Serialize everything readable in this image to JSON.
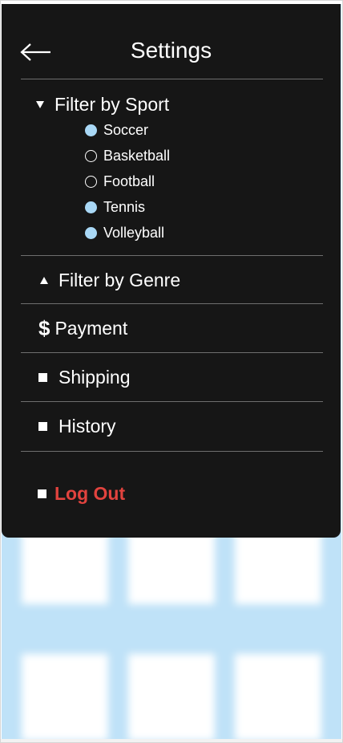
{
  "header": {
    "title": "Settings",
    "back_icon": "arrow-left-icon"
  },
  "filter_sport": {
    "label": "Filter by Sport",
    "expanded": true,
    "options": [
      {
        "label": "Soccer",
        "selected": true
      },
      {
        "label": "Basketball",
        "selected": false
      },
      {
        "label": "Football",
        "selected": false
      },
      {
        "label": "Tennis",
        "selected": true
      },
      {
        "label": "Volleyball",
        "selected": true
      }
    ]
  },
  "filter_genre": {
    "label": "Filter by Genre",
    "expanded": false
  },
  "menu": {
    "payment": {
      "label": "Payment",
      "icon": "$"
    },
    "shipping": {
      "label": "Shipping"
    },
    "history": {
      "label": "History"
    },
    "logout": {
      "label": "Log Out"
    }
  },
  "colors": {
    "panel": "#161616",
    "selected_radio": "#a9d8f6",
    "logout": "#e2433e",
    "background": "#bfe2f8"
  }
}
